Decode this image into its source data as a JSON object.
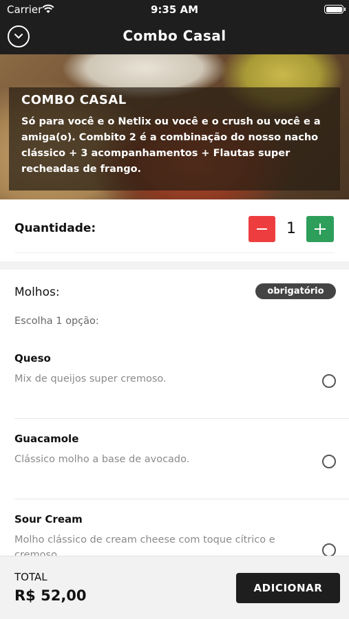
{
  "status_bar": {
    "carrier": "Carrier",
    "time": "9:35 AM"
  },
  "nav": {
    "title": "Combo Casal",
    "back_icon": "chevron-down-circle-icon"
  },
  "hero": {
    "title": "COMBO CASAL",
    "description": "Só para você e o Netlix ou você e o crush ou você e a amiga(o). Combito 2 é a combinação do nosso nacho clássico + 3 acompanhamentos + Flautas super recheadas de frango."
  },
  "quantity": {
    "label": "Quantidade:",
    "value": "1",
    "minus_color": "#ee3d3f",
    "plus_color": "#2e9e5b"
  },
  "sauces": {
    "title": "Molhos:",
    "badge": "obrigatório",
    "instruction": "Escolha 1 opção:",
    "options": [
      {
        "name": "Queso",
        "description": "Mix de queijos super cremoso."
      },
      {
        "name": "Guacamole",
        "description": "Clássico molho a base de avocado."
      },
      {
        "name": "Sour Cream",
        "description": "Molho clássico de cream cheese com toque cítrico e cremoso."
      }
    ]
  },
  "footer": {
    "total_label": "TOTAL",
    "total_value": "R$ 52,00",
    "add_button": "ADICIONAR"
  }
}
